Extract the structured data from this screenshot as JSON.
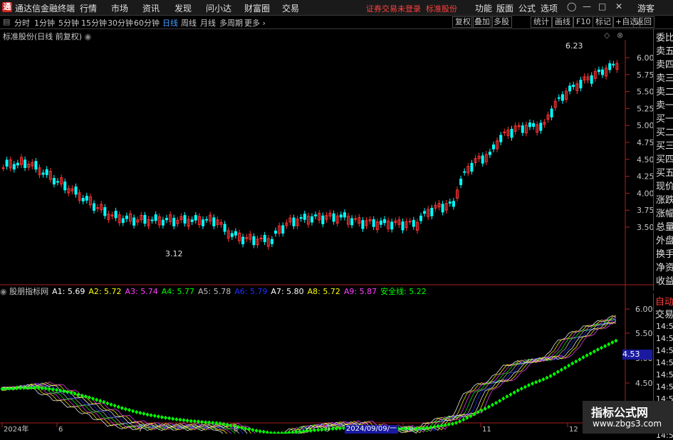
{
  "titlebar": {
    "logo": "通",
    "app_name": "通达信金融终端",
    "menus": [
      "行情",
      "市场",
      "资讯",
      "发现",
      "问小达",
      "财富圈",
      "交易"
    ],
    "warning": "证券交易未登录",
    "stock_name": "标准股份",
    "right_menus": [
      "功能",
      "版面",
      "公式",
      "选项"
    ],
    "guest": "游客"
  },
  "toolbar": {
    "periods": [
      "分时",
      "1分钟",
      "5分钟",
      "15分钟",
      "30分钟",
      "60分钟",
      "日线",
      "周线",
      "月线",
      "多周期",
      "更多"
    ],
    "active": "日线",
    "buttons": [
      "复权",
      "叠加",
      "多股",
      "统计",
      "画线",
      "F10",
      "标记",
      "+自选",
      "返回"
    ]
  },
  "chart_title": "标准股份(日线 前复权)",
  "price_axis": [
    "6.00",
    "5.75",
    "5.50",
    "5.25",
    "5.00",
    "4.75",
    "4.50",
    "4.25",
    "4.00",
    "3.75",
    "3.50"
  ],
  "high_label": "6.23",
  "low_label": "3.12",
  "sidebar": [
    "委比",
    "卖五",
    "卖四",
    "卖三",
    "卖二",
    "卖一",
    "买一",
    "买二",
    "买三",
    "买四",
    "买五",
    "现价",
    "涨跌",
    "涨幅",
    "总量",
    "外盘",
    "换手",
    "净资",
    "收益"
  ],
  "sidebar2": {
    "auto": "自动",
    "trade": "交易",
    "times": [
      "14:55",
      "14:56",
      "14:56",
      "14:56",
      "14:56",
      "14:56",
      "14:56",
      "14:56",
      "14:56",
      "14:56"
    ]
  },
  "indicator": {
    "name": "股朋指标网",
    "items": [
      {
        "label": "A1:",
        "value": "5.69",
        "color": "#ffffff"
      },
      {
        "label": "A2:",
        "value": "5.72",
        "color": "#ffff00"
      },
      {
        "label": "A3:",
        "value": "5.74",
        "color": "#ff40ff"
      },
      {
        "label": "A4:",
        "value": "5.77",
        "color": "#00ff00"
      },
      {
        "label": "A5:",
        "value": "5.78",
        "color": "#c0c0c0"
      },
      {
        "label": "A6:",
        "value": "5.79",
        "color": "#2030ff"
      },
      {
        "label": "A7:",
        "value": "5.80",
        "color": "#ffffff"
      },
      {
        "label": "A8:",
        "value": "5.72",
        "color": "#ffff00"
      },
      {
        "label": "A9:",
        "value": "5.87",
        "color": "#ff40ff"
      },
      {
        "label": "安全线:",
        "value": "5.22",
        "color": "#00ff00"
      }
    ],
    "axis": [
      "6.00",
      "5.50",
      "5.00",
      "4.50",
      "4.00"
    ],
    "current": "4.53"
  },
  "date_axis": [
    "2024年",
    "6",
    "7",
    "8",
    "9",
    "10",
    "11",
    "12"
  ],
  "date_label": "2024/09/09/一",
  "watermark": {
    "line1": "指标公式网",
    "line2": "www.zbgs3.com"
  },
  "colors": {
    "up": "#ff3232",
    "down": "#00ffff",
    "green": "#00ff00"
  }
}
